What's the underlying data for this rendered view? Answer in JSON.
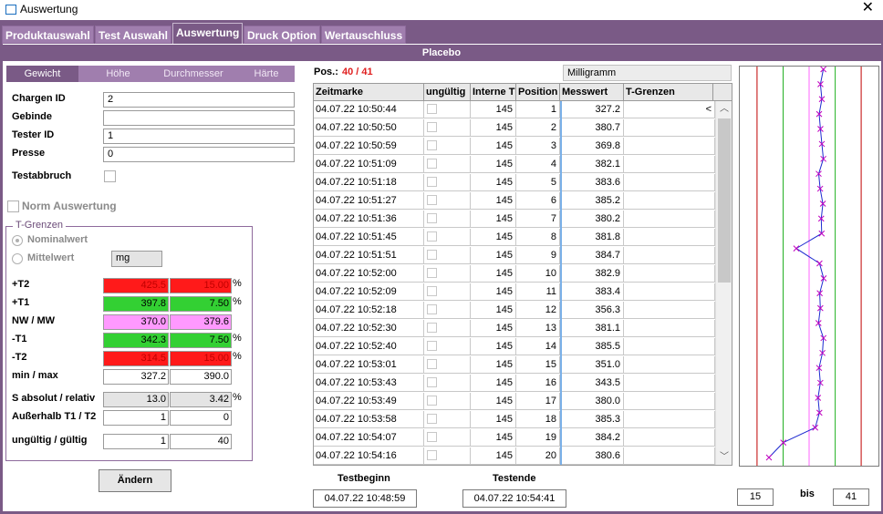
{
  "window": {
    "title": "Auswertung",
    "close_icon": "close-icon"
  },
  "tabs": [
    {
      "label": "Produktauswahl",
      "active": false
    },
    {
      "label": "Test Auswahl",
      "active": false
    },
    {
      "label": "Auswertung",
      "active": true
    },
    {
      "label": "Druck Option",
      "active": false
    },
    {
      "label": "Wertauschluss",
      "active": false
    }
  ],
  "subtitle": "Placebo",
  "subtabs": [
    {
      "label": "Gewicht",
      "active": true
    },
    {
      "label": "Höhe",
      "active": false
    },
    {
      "label": "Durchmesser",
      "active": false
    },
    {
      "label": "Härte",
      "active": false
    }
  ],
  "form": {
    "chargen_id_label": "Chargen ID",
    "chargen_id": "2",
    "gebinde_label": "Gebinde",
    "gebinde": "",
    "tester_id_label": "Tester ID",
    "tester_id": "1",
    "presse_label": "Presse",
    "presse": "0",
    "testabbruch_label": "Testabbruch",
    "norm_label": "Norm Auswertung"
  },
  "tgrenzen": {
    "title": "T-Grenzen",
    "nominal_label": "Nominalwert",
    "mittel_label": "Mittelwert",
    "unit": "mg",
    "rows": [
      {
        "label": "+T2",
        "v1": "425.5",
        "v2": "15.00",
        "pct": "%",
        "color": "red"
      },
      {
        "label": "+T1",
        "v1": "397.8",
        "v2": "7.50",
        "pct": "%",
        "color": "green"
      },
      {
        "label": "NW / MW",
        "v1": "370.0",
        "v2": "379.6",
        "pct": "",
        "color": "pink"
      },
      {
        "label": "-T1",
        "v1": "342.3",
        "v2": "7.50",
        "pct": "%",
        "color": "green"
      },
      {
        "label": "-T2",
        "v1": "314.5",
        "v2": "15.00",
        "pct": "%",
        "color": "red"
      },
      {
        "label": "min / max",
        "v1": "327.2",
        "v2": "390.0",
        "pct": "",
        "color": "white"
      }
    ],
    "s_label": "S absolut / relativ",
    "s_abs": "13.0",
    "s_rel": "3.42",
    "s_pct": "%",
    "aus_label": "Außerhalb T1 / T2",
    "aus_t1": "1",
    "aus_t2": "0",
    "ung_label": "ungültig / gültig",
    "ung": "1",
    "gue": "40"
  },
  "aendern_label": "Ändern",
  "pos": {
    "label": "Pos.:",
    "value": "40 / 41"
  },
  "unit_display": "Milligramm",
  "table": {
    "headers": [
      "Zeitmarke",
      "ungültig",
      "Interne T",
      "Position",
      "Messwert",
      "T-Grenzen"
    ],
    "rows": [
      {
        "zeit": "04.07.22 10:50:44",
        "intern": "145",
        "pos": "1",
        "wert": "327.2",
        "tg": "<"
      },
      {
        "zeit": "04.07.22 10:50:50",
        "intern": "145",
        "pos": "2",
        "wert": "380.7",
        "tg": ""
      },
      {
        "zeit": "04.07.22 10:50:59",
        "intern": "145",
        "pos": "3",
        "wert": "369.8",
        "tg": ""
      },
      {
        "zeit": "04.07.22 10:51:09",
        "intern": "145",
        "pos": "4",
        "wert": "382.1",
        "tg": ""
      },
      {
        "zeit": "04.07.22 10:51:18",
        "intern": "145",
        "pos": "5",
        "wert": "383.6",
        "tg": ""
      },
      {
        "zeit": "04.07.22 10:51:27",
        "intern": "145",
        "pos": "6",
        "wert": "385.2",
        "tg": ""
      },
      {
        "zeit": "04.07.22 10:51:36",
        "intern": "145",
        "pos": "7",
        "wert": "380.2",
        "tg": ""
      },
      {
        "zeit": "04.07.22 10:51:45",
        "intern": "145",
        "pos": "8",
        "wert": "381.8",
        "tg": ""
      },
      {
        "zeit": "04.07.22 10:51:51",
        "intern": "145",
        "pos": "9",
        "wert": "384.7",
        "tg": ""
      },
      {
        "zeit": "04.07.22 10:52:00",
        "intern": "145",
        "pos": "10",
        "wert": "382.9",
        "tg": ""
      },
      {
        "zeit": "04.07.22 10:52:09",
        "intern": "145",
        "pos": "11",
        "wert": "383.4",
        "tg": ""
      },
      {
        "zeit": "04.07.22 10:52:18",
        "intern": "145",
        "pos": "12",
        "wert": "356.3",
        "tg": ""
      },
      {
        "zeit": "04.07.22 10:52:30",
        "intern": "145",
        "pos": "13",
        "wert": "381.1",
        "tg": ""
      },
      {
        "zeit": "04.07.22 10:52:40",
        "intern": "145",
        "pos": "14",
        "wert": "385.5",
        "tg": ""
      },
      {
        "zeit": "04.07.22 10:53:01",
        "intern": "145",
        "pos": "15",
        "wert": "351.0",
        "tg": ""
      },
      {
        "zeit": "04.07.22 10:53:43",
        "intern": "145",
        "pos": "16",
        "wert": "343.5",
        "tg": ""
      },
      {
        "zeit": "04.07.22 10:53:49",
        "intern": "145",
        "pos": "17",
        "wert": "380.0",
        "tg": ""
      },
      {
        "zeit": "04.07.22 10:53:58",
        "intern": "145",
        "pos": "18",
        "wert": "385.3",
        "tg": ""
      },
      {
        "zeit": "04.07.22 10:54:07",
        "intern": "145",
        "pos": "19",
        "wert": "384.2",
        "tg": ""
      },
      {
        "zeit": "04.07.22 10:54:16",
        "intern": "145",
        "pos": "20",
        "wert": "380.6",
        "tg": ""
      }
    ]
  },
  "testbeginn_label": "Testbeginn",
  "testbeginn": "04.07.22 10:48:59",
  "testende_label": "Testende",
  "testende": "04.07.22 10:54:41",
  "range": {
    "from": "15",
    "bis_label": "bis",
    "to": "41"
  },
  "chart_data": {
    "type": "line",
    "orientation": "vertical",
    "x_range": [
      300,
      440
    ],
    "limits": [
      {
        "name": "-T2",
        "value": 314.5,
        "color": "#c00000"
      },
      {
        "name": "-T1",
        "value": 342.3,
        "color": "#22b022"
      },
      {
        "name": "NW",
        "value": 370.0,
        "color": "#ff66ff"
      },
      {
        "name": "+T1",
        "value": 397.8,
        "color": "#22b022"
      },
      {
        "name": "+T2",
        "value": 425.5,
        "color": "#c00000"
      }
    ],
    "series_color": "#1f2bd0",
    "marker_color": "#c000c0",
    "values": [
      385.2,
      382.1,
      383.6,
      380.7,
      382.1,
      383.6,
      385.2,
      380.2,
      381.8,
      384.7,
      382.9,
      383.4,
      356.3,
      381.1,
      385.5,
      381.3,
      382.0,
      380.0,
      385.3,
      384.2,
      380.6,
      382.0,
      379.5,
      381.0,
      376.5,
      342.5,
      327.2
    ]
  }
}
